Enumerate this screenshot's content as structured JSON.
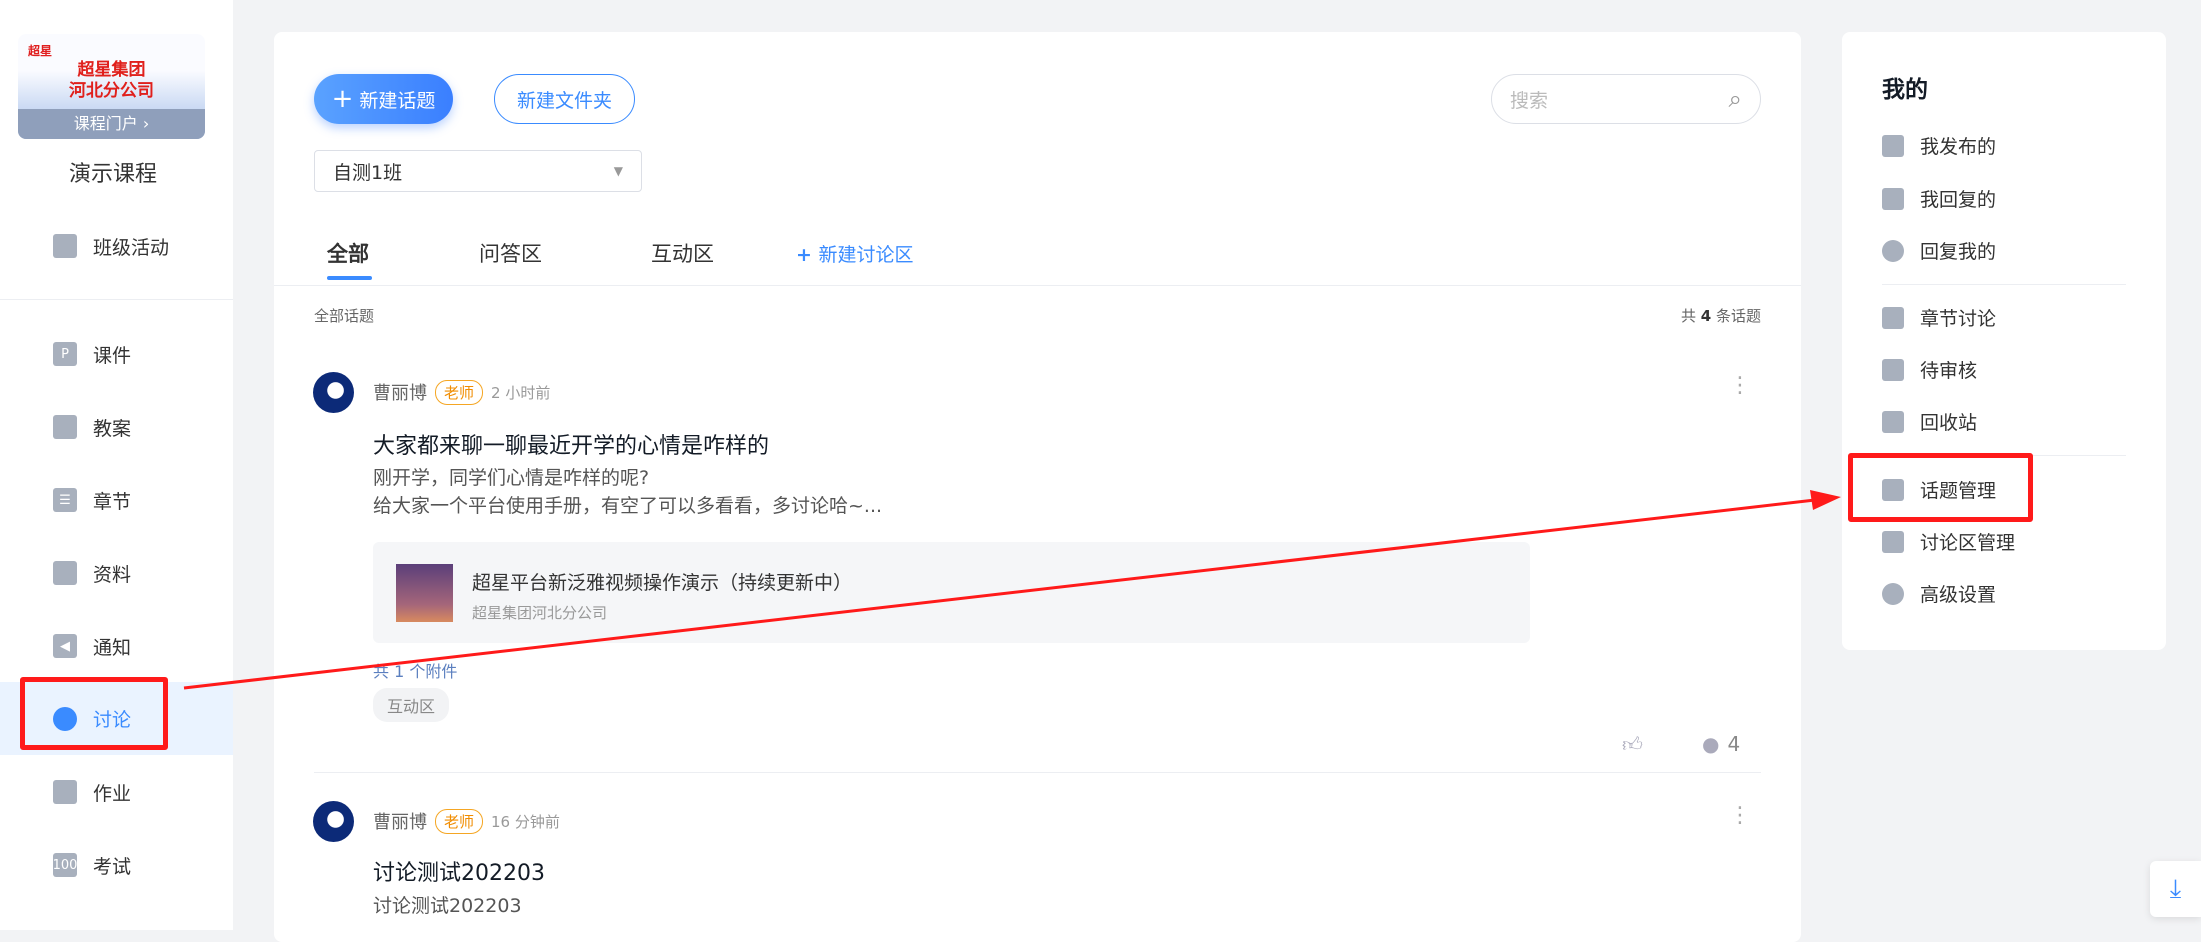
{
  "sidebar": {
    "logo_brand": "超星",
    "logo_org_line1": "超星集团",
    "logo_org_line2": "河北分公司",
    "portal_label": "课程门户 ›",
    "course_name": "演示课程",
    "class_activity": "班级活动",
    "items": [
      {
        "label": "课件",
        "icon": "courseware-icon"
      },
      {
        "label": "教案",
        "icon": "lesson-plan-icon"
      },
      {
        "label": "章节",
        "icon": "chapter-icon"
      },
      {
        "label": "资料",
        "icon": "folder-icon"
      },
      {
        "label": "通知",
        "icon": "speaker-icon"
      },
      {
        "label": "讨论",
        "icon": "chat-icon",
        "active": true
      },
      {
        "label": "作业",
        "icon": "homework-icon"
      },
      {
        "label": "考试",
        "icon": "exam-icon"
      }
    ]
  },
  "toolbar": {
    "new_topic": "新建话题",
    "new_folder": "新建文件夹",
    "search_placeholder": "搜索",
    "class_select": "自测1班"
  },
  "tabs": [
    {
      "label": "全部",
      "active": true
    },
    {
      "label": "问答区"
    },
    {
      "label": "互动区"
    },
    {
      "label": "新建讨论区"
    }
  ],
  "list": {
    "heading": "全部话题",
    "count_prefix": "共",
    "count": "4",
    "count_suffix": "条话题"
  },
  "posts": [
    {
      "author": "曹丽博",
      "role": "老师",
      "time": "2 小时前",
      "title": "大家都来聊一聊最近开学的心情是咋样的",
      "body1": "刚开学，同学们心情是咋样的呢?",
      "body2": "给大家一个平台使用手册，有空了可以多看看，多讨论哈~...",
      "attachment_title": "超星平台新泛雅视频操作演示（持续更新中）",
      "attachment_source": "超星集团河北分公司",
      "attachment_count": "共 1 个附件",
      "tag": "互动区",
      "comments": "4"
    },
    {
      "author": "曹丽博",
      "role": "老师",
      "time": "16 分钟前",
      "title": "讨论测试202203",
      "body1": "讨论测试202203"
    }
  ],
  "right": {
    "title": "我的",
    "items": [
      "我发布的",
      "我回复的",
      "回复我的",
      "章节讨论",
      "待审核",
      "回收站",
      "话题管理",
      "讨论区管理",
      "高级设置"
    ]
  },
  "colors": {
    "accent": "#3a8bff",
    "annotation": "#ff1a1a"
  }
}
